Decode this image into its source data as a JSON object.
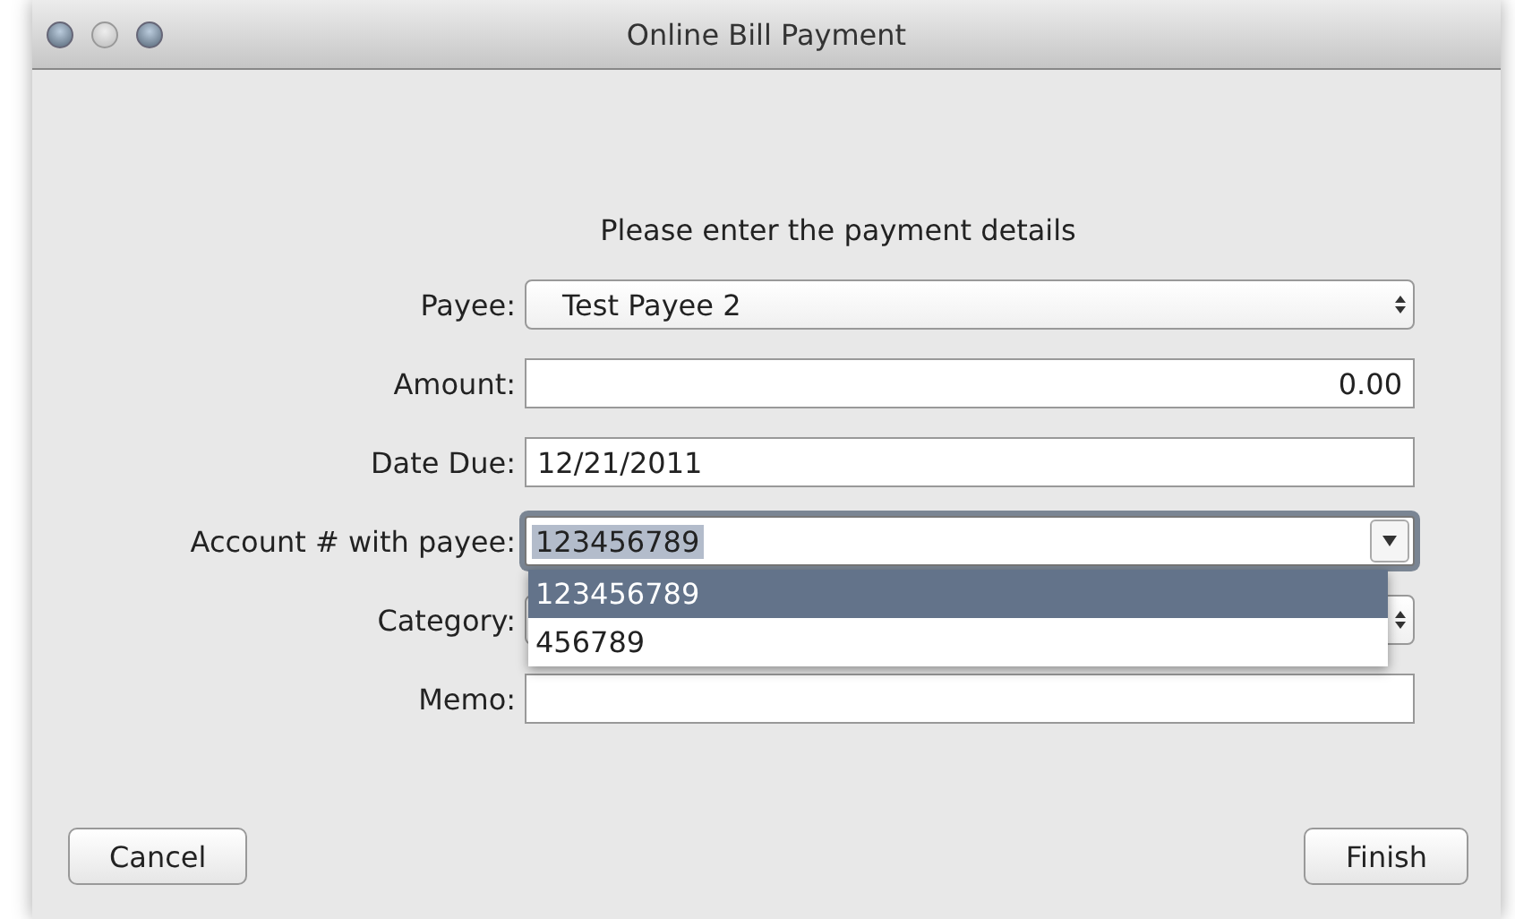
{
  "window": {
    "title": "Online Bill Payment"
  },
  "heading": "Please enter the payment details",
  "fields": [
    {
      "label": "Payee:",
      "kind": "popup",
      "value": "Test Payee 2"
    },
    {
      "label": "Amount:",
      "kind": "number",
      "value": "0.00"
    },
    {
      "label": "Date Due:",
      "kind": "text",
      "value": "12/21/2011"
    },
    {
      "label": "Account # with payee:",
      "kind": "combo",
      "value": "123456789",
      "expanded": true,
      "options": [
        {
          "label": "123456789",
          "selected": true
        },
        {
          "label": "456789",
          "selected": false
        }
      ]
    },
    {
      "label": "Category:",
      "kind": "popup"
    },
    {
      "label": "Memo:",
      "kind": "text"
    }
  ],
  "buttons": [
    {
      "label": "Cancel"
    },
    {
      "label": "Finish"
    }
  ]
}
